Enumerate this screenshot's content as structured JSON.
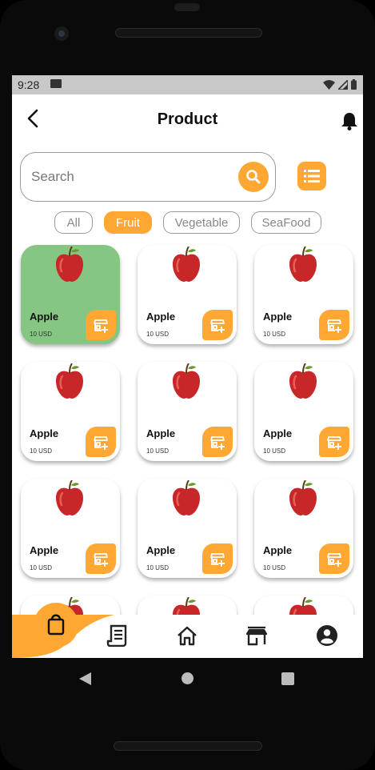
{
  "status_bar": {
    "time": "9:28"
  },
  "header": {
    "title": "Product"
  },
  "search": {
    "placeholder": "Search"
  },
  "filters": [
    {
      "label": "All",
      "active": false
    },
    {
      "label": "Fruit",
      "active": true
    },
    {
      "label": "Vegetable",
      "active": false
    },
    {
      "label": "SeaFood",
      "active": false
    }
  ],
  "products": [
    {
      "name": "Apple",
      "price": "10 USD",
      "selected": true
    },
    {
      "name": "Apple",
      "price": "10 USD",
      "selected": false
    },
    {
      "name": "Apple",
      "price": "10 USD",
      "selected": false
    },
    {
      "name": "Apple",
      "price": "10 USD",
      "selected": false
    },
    {
      "name": "Apple",
      "price": "10 USD",
      "selected": false
    },
    {
      "name": "Apple",
      "price": "10 USD",
      "selected": false
    },
    {
      "name": "Apple",
      "price": "10 USD",
      "selected": false
    },
    {
      "name": "Apple",
      "price": "10 USD",
      "selected": false
    },
    {
      "name": "Apple",
      "price": "10 USD",
      "selected": false
    }
  ],
  "bottom_nav": {
    "items": [
      {
        "icon": "shopping-bag-icon",
        "active": true
      },
      {
        "icon": "receipt-icon",
        "active": false
      },
      {
        "icon": "home-icon",
        "active": false
      },
      {
        "icon": "store-icon",
        "active": false
      },
      {
        "icon": "account-icon",
        "active": false
      }
    ]
  },
  "colors": {
    "accent": "#ffa733",
    "selected_card": "#85c682"
  }
}
